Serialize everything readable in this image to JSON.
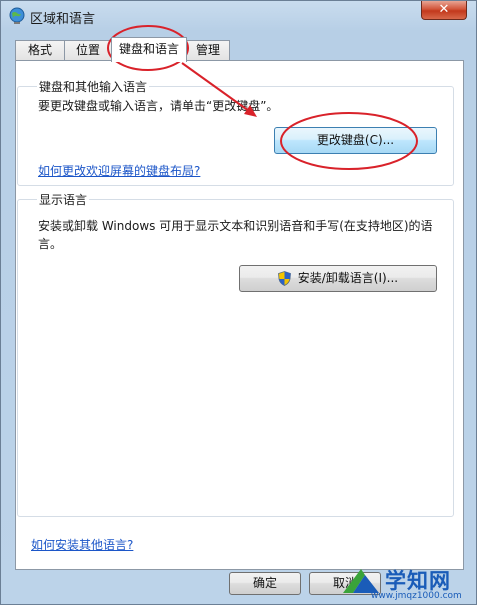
{
  "window": {
    "title": "区域和语言",
    "close_label": "✕"
  },
  "tabs": [
    {
      "label": "格式",
      "active": false
    },
    {
      "label": "位置",
      "active": false
    },
    {
      "label": "键盘和语言",
      "active": true
    },
    {
      "label": "管理",
      "active": false
    }
  ],
  "keyboard_group": {
    "title": "键盘和其他输入语言",
    "description": "要更改键盘或输入语言，请单击“更改键盘”。",
    "button_label": "更改键盘(C)...",
    "link": "如何更改欢迎屏幕的键盘布局?"
  },
  "display_group": {
    "title": "显示语言",
    "description_line1": "安装或卸载 Windows 可用于显示文本和识别语音和手写(在支持地区)的语",
    "description_line2": "言。",
    "button_label": "安装/卸载语言(I)..."
  },
  "footer": {
    "link": "如何安装其他语言?",
    "ok_label": "确定",
    "cancel_label": "取消"
  },
  "watermark": {
    "text": "学知网",
    "url": "www.jmqz1000.com"
  },
  "colors": {
    "annotation": "#d9222a",
    "link": "#1c56c8"
  }
}
